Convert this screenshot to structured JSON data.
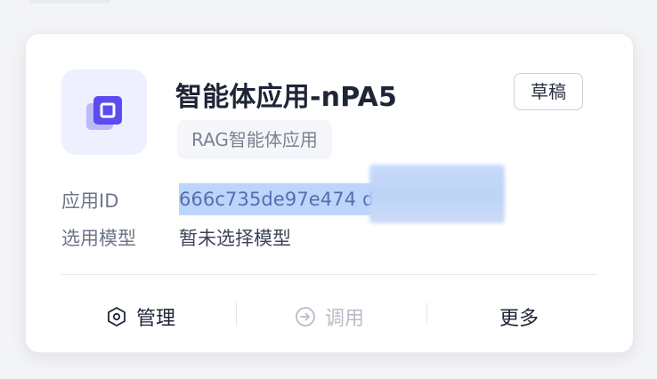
{
  "card": {
    "title": "智能体应用-nPA5",
    "status_badge": "草稿",
    "tag": "RAG智能体应用",
    "icon": "app-square-icon",
    "details": {
      "app_id_label": "应用ID",
      "app_id_value": "666c735de97e474 d5bb52",
      "model_label": "选用模型",
      "model_value": "暂未选择模型"
    },
    "actions": [
      {
        "label": "管理",
        "icon": "hexagon-settings-icon",
        "enabled": true
      },
      {
        "label": "调用",
        "icon": "arrow-circle-icon",
        "enabled": false
      },
      {
        "label": "更多",
        "icon": "",
        "enabled": true
      }
    ]
  },
  "colors": {
    "accent": "#5a4ff0",
    "selection": "#bcd5fb",
    "disabled": "#b9bdc8"
  }
}
